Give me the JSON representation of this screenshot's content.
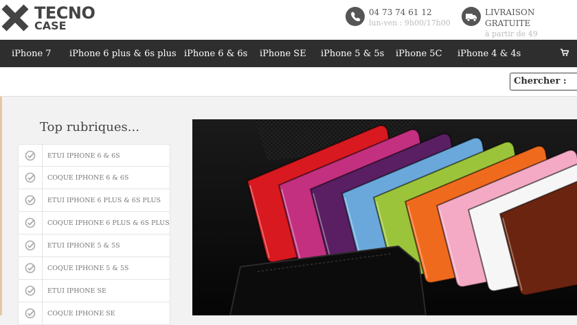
{
  "brand": {
    "line1": "TECNO",
    "line2": "CASE"
  },
  "contact": {
    "phone": "04 73 74 61 12",
    "hours": "lun-ven : 9h00/17h00"
  },
  "shipping": {
    "line1": "LIVRAISON",
    "line2": "GRATUITE",
    "line3": "à partir de 49"
  },
  "nav": {
    "items": [
      "iPhone 7",
      "iPhone 6 plus & 6s plus",
      "iPhone 6 & 6s",
      "iPhone SE",
      "iPhone 5 & 5s",
      "iPhone 5C",
      "iPhone 4 & 4s"
    ],
    "cart_icon": "cart-icon"
  },
  "search": {
    "label": "Chercher :"
  },
  "sidebar": {
    "title": "Top rubriques...",
    "items": [
      "ETUI IPHONE 6 & 6S",
      "COQUE IPHONE 6 & 6S",
      "ETUI IPHONE 6 PLUS & 6S PLUS",
      "COQUE IPHONE 6 PLUS & 6S PLUS",
      "ETUI IPHONE 5 & 5S",
      "COQUE IPHONE 5 & 5S",
      "ETUI IPHONE SE",
      "COQUE IPHONE SE"
    ]
  },
  "banner": {
    "case_colors": [
      "#d8191f",
      "#c2307f",
      "#5a1e63",
      "#6aa8dc",
      "#9cc43a",
      "#f06a1e",
      "#f4aac4",
      "#f6f6f6",
      "#6b2410"
    ]
  }
}
